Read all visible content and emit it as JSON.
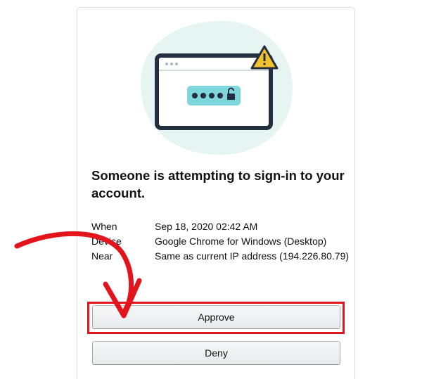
{
  "prompt": {
    "title": "Someone is attempting to sign-in to your account."
  },
  "details": [
    {
      "label": "When",
      "value": "Sep 18, 2020 02:42 AM"
    },
    {
      "label": "Device",
      "value": "Google Chrome for Windows (Desktop)"
    },
    {
      "label": "Near",
      "value": "Same as current IP address (194.226.80.79)"
    }
  ],
  "actions": {
    "approve_label": "Approve",
    "deny_label": "Deny"
  },
  "icons": {
    "illustration": "browser-password-warning-icon",
    "warning": "warning-triangle-icon",
    "lock": "lock-icon",
    "annotation": "red-arrow-icon"
  },
  "colors": {
    "accent_red": "#e3141b",
    "blob": "#e6f5f2",
    "screen_dark": "#232f3e",
    "password_field": "#7fd6da",
    "warning": "#f3c12b"
  }
}
